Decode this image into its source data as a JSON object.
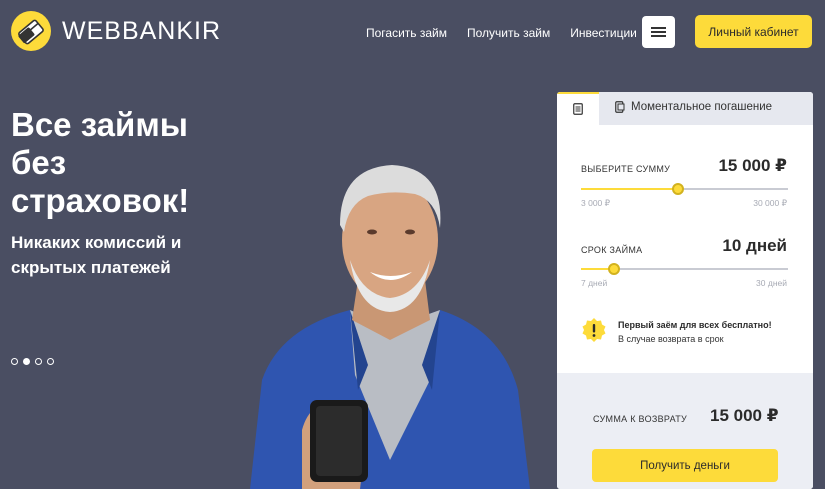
{
  "brand": {
    "name": "WEBBANKIR",
    "logo_color": "#fddb3a"
  },
  "nav": {
    "items": [
      {
        "label": "Погасить займ"
      },
      {
        "label": "Получить займ"
      },
      {
        "label": "Инвестиции"
      }
    ],
    "menu_icon": "hamburger-icon",
    "cabinet_label": "Личный кабинет"
  },
  "hero": {
    "title_lines": [
      "Все займы",
      "без",
      "страховок!"
    ],
    "subtitle_lines": [
      "Никаких комиссий и",
      "скрытых платежей"
    ],
    "slides_total": 4,
    "active_slide": 2
  },
  "calculator": {
    "tabs": [
      {
        "icon": "document-icon",
        "label": ""
      },
      {
        "icon": "phone-icon",
        "label": "Моментальное погашение"
      }
    ],
    "amount": {
      "label": "ВЫБЕРИТЕ СУММУ",
      "value": "15 000 ₽",
      "min": "3 000 ₽",
      "max": "30 000 ₽",
      "fraction": 0.47
    },
    "term": {
      "label": "СРОК ЗАЙМА",
      "value": "10 дней",
      "min": "7 дней",
      "max": "30 дней",
      "fraction": 0.16
    },
    "notice": {
      "icon": "alert-icon",
      "title": "Первый заём для всех бесплатно!",
      "text": "В случае возврата в срок"
    },
    "total": {
      "label": "СУММА К ВОЗВРАТУ",
      "value": "15 000 ₽"
    },
    "submit_label": "Получить деньги"
  },
  "colors": {
    "background": "#4a4e62",
    "accent": "#fddb3a",
    "card_bottom": "#eceef4"
  }
}
